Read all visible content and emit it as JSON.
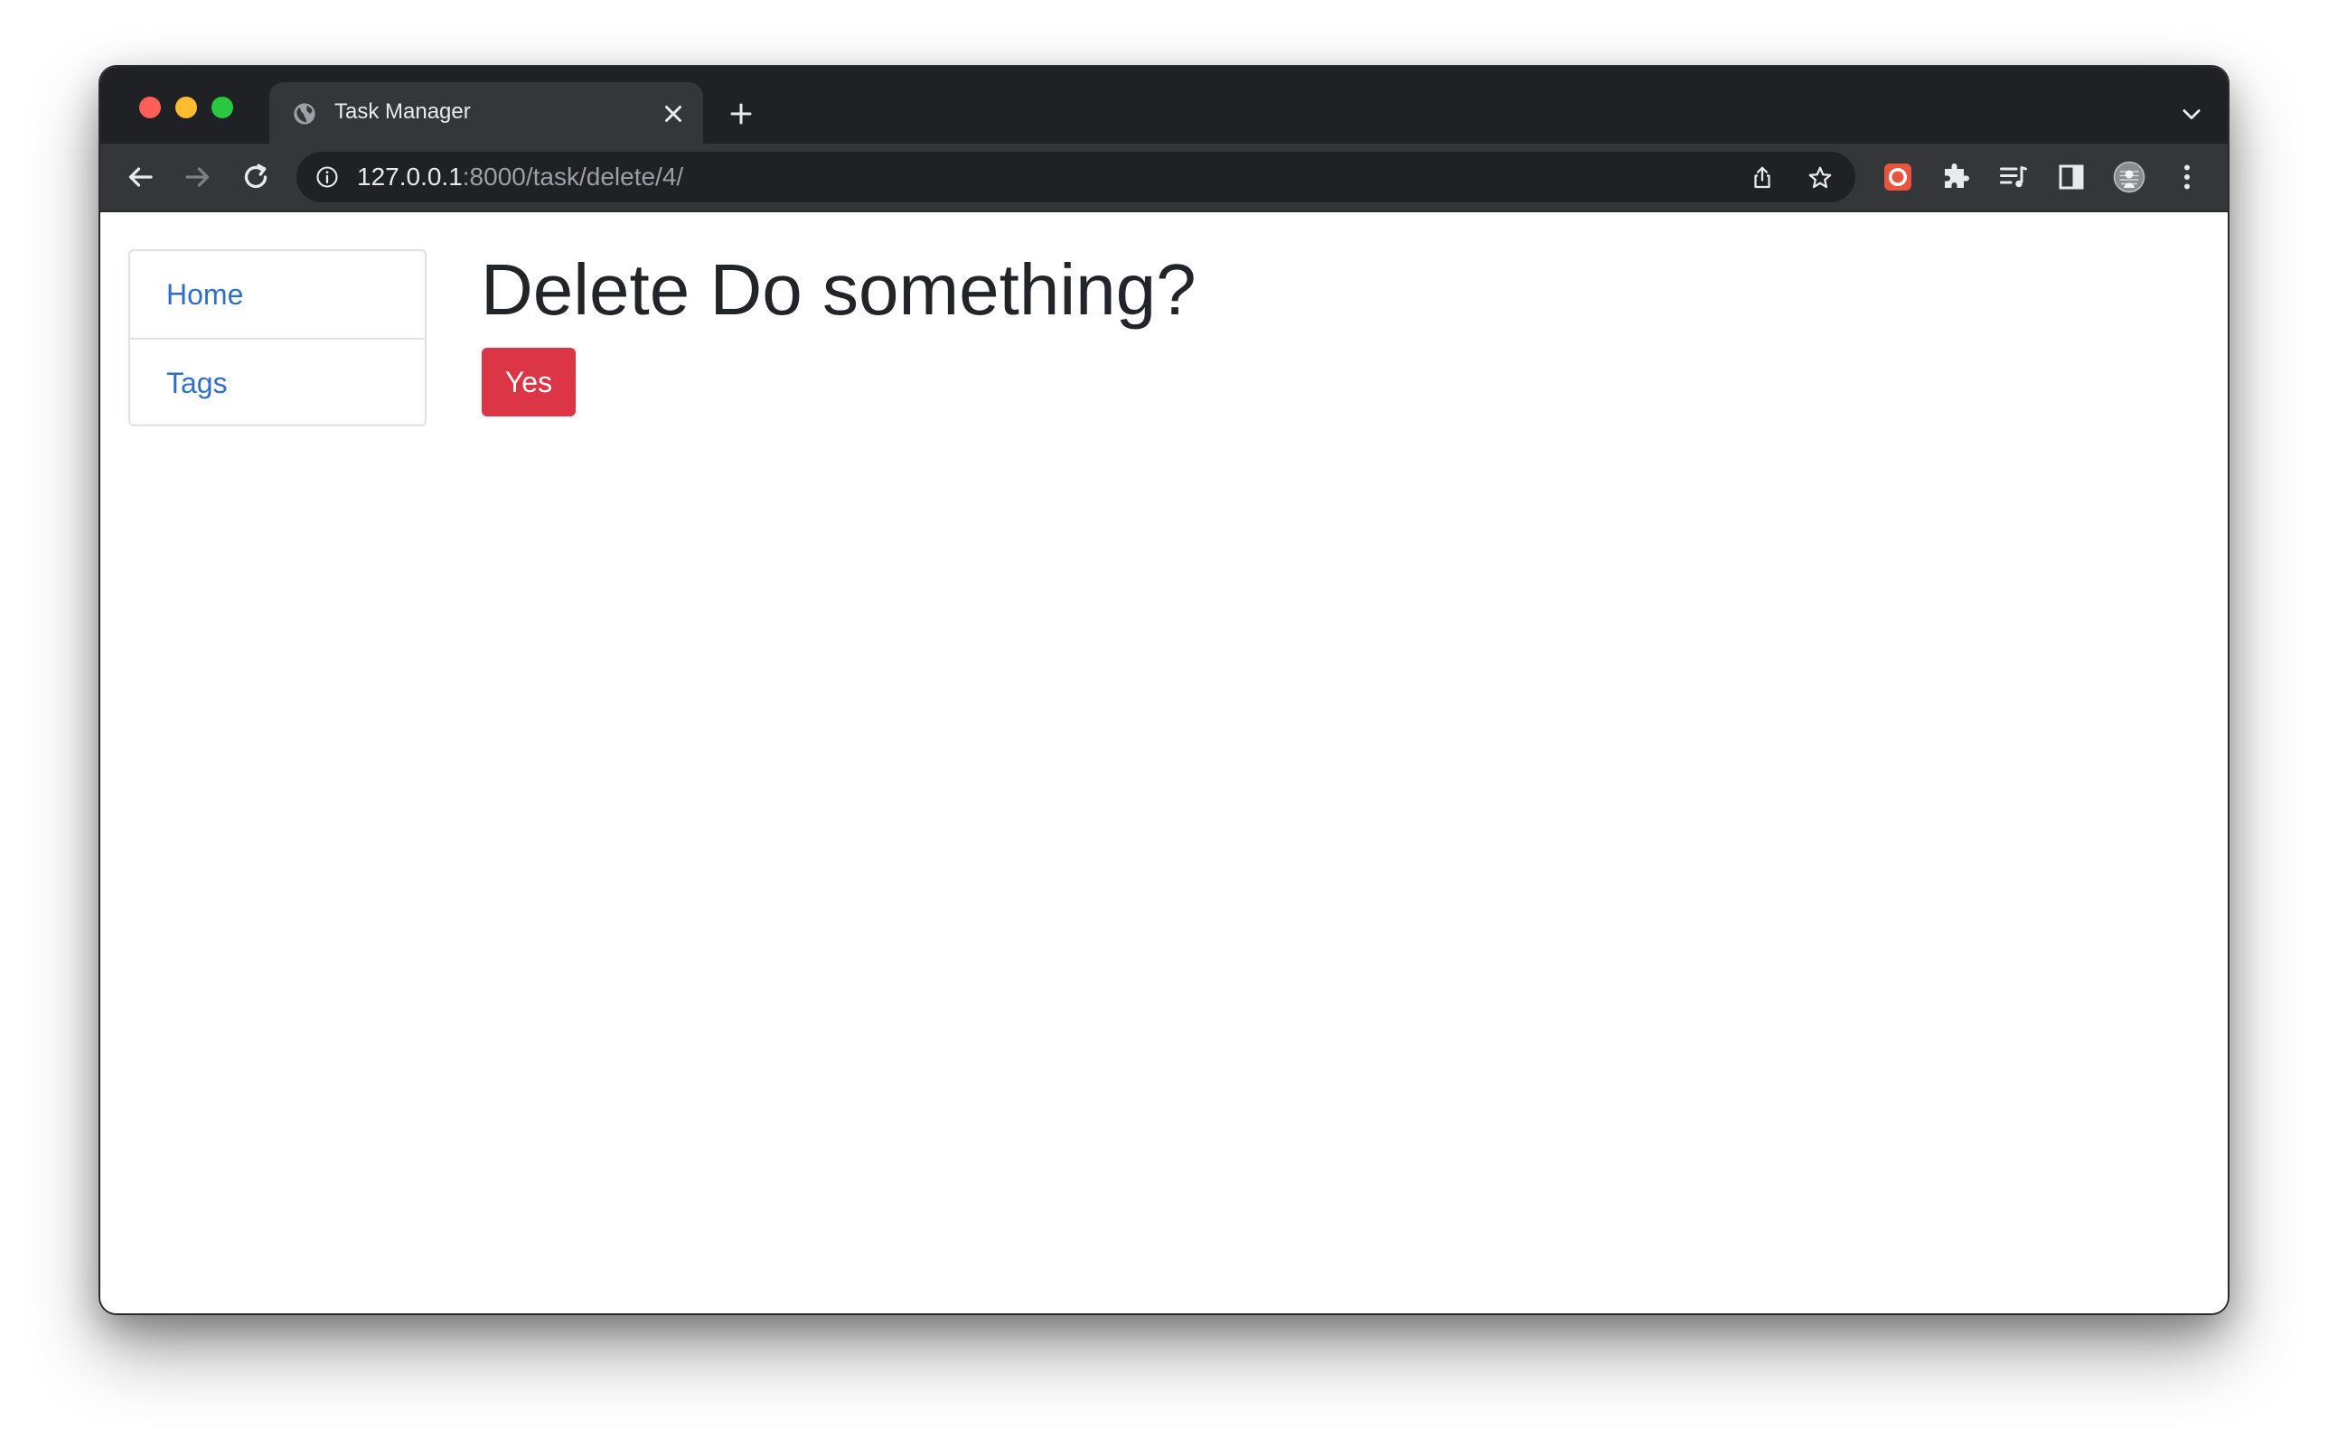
{
  "browser": {
    "tab": {
      "title": "Task Manager"
    },
    "address_bar": {
      "host": "127.0.0.1",
      "path": ":8000/task/delete/4/"
    }
  },
  "sidebar": {
    "items": [
      {
        "label": "Home"
      },
      {
        "label": "Tags"
      }
    ]
  },
  "main": {
    "heading": "Delete Do something?",
    "confirm_button_label": "Yes"
  },
  "colors": {
    "link": "#2f6fc9",
    "danger_button": "#dc3545",
    "heading_text": "#212529",
    "browser_frame": "#202124",
    "toolbar": "#35363a"
  },
  "icons": {
    "tab_favicon": "globe-icon",
    "tab_close": "close-icon",
    "new_tab": "plus-icon",
    "tab_search": "chevron-down-icon",
    "back": "arrow-left-icon",
    "forward": "arrow-right-icon",
    "reload": "reload-icon",
    "site_info": "info-icon",
    "share": "share-icon",
    "bookmark": "star-icon",
    "extension_1": "red-circle-extension-icon",
    "extensions": "puzzle-icon",
    "media": "media-queue-icon",
    "side_panel": "side-panel-icon",
    "profile": "avatar",
    "menu": "kebab-menu-icon"
  }
}
